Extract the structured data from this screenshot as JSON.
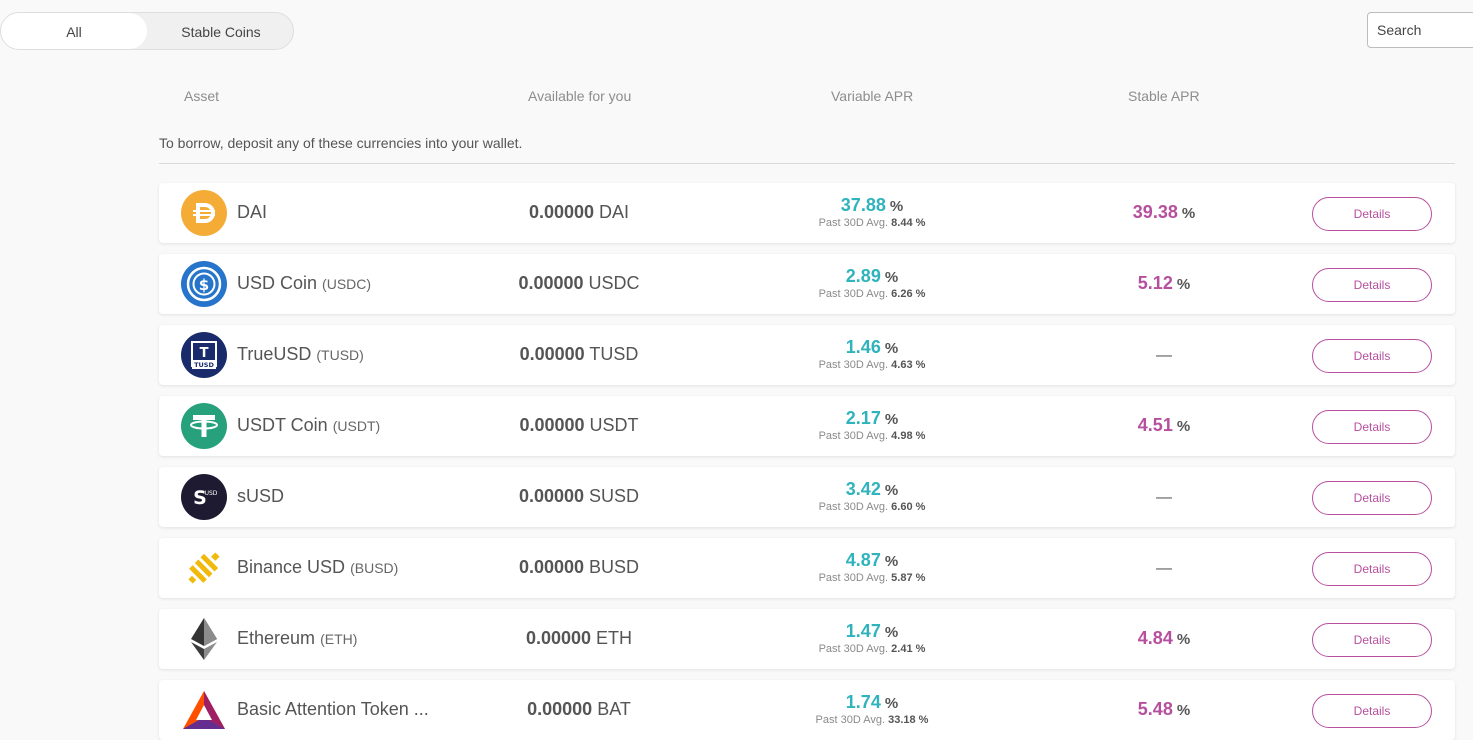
{
  "tabs": {
    "all": "All",
    "stable": "Stable Coins"
  },
  "search": {
    "placeholder": "Search"
  },
  "headers": {
    "asset": "Asset",
    "available": "Available for you",
    "variable": "Variable APR",
    "stable": "Stable APR"
  },
  "notice": "To borrow, deposit any of these currencies into your wallet.",
  "percent_sign": "%",
  "details_label": "Details",
  "avg_label": "Past 30D Avg.",
  "colors": {
    "variable": "#2fb3bc",
    "stable": "#b6509e"
  },
  "rows": [
    {
      "name": "DAI",
      "symbol": "",
      "amount": "0.00000",
      "unit": "DAI",
      "variable": "37.88",
      "avg": "8.44 %",
      "stable": "39.38",
      "icon": "dai-icon"
    },
    {
      "name": "USD Coin",
      "symbol": "(USDC)",
      "amount": "0.00000",
      "unit": "USDC",
      "variable": "2.89",
      "avg": "6.26 %",
      "stable": "5.12",
      "icon": "usdc-icon"
    },
    {
      "name": "TrueUSD",
      "symbol": "(TUSD)",
      "amount": "0.00000",
      "unit": "TUSD",
      "variable": "1.46",
      "avg": "4.63 %",
      "stable": "—",
      "icon": "tusd-icon"
    },
    {
      "name": "USDT Coin",
      "symbol": "(USDT)",
      "amount": "0.00000",
      "unit": "USDT",
      "variable": "2.17",
      "avg": "4.98 %",
      "stable": "4.51",
      "icon": "usdt-icon"
    },
    {
      "name": "sUSD",
      "symbol": "",
      "amount": "0.00000",
      "unit": "SUSD",
      "variable": "3.42",
      "avg": "6.60 %",
      "stable": "—",
      "icon": "susd-icon"
    },
    {
      "name": "Binance USD",
      "symbol": "(BUSD)",
      "amount": "0.00000",
      "unit": "BUSD",
      "variable": "4.87",
      "avg": "5.87 %",
      "stable": "—",
      "icon": "busd-icon"
    },
    {
      "name": "Ethereum",
      "symbol": "(ETH)",
      "amount": "0.00000",
      "unit": "ETH",
      "variable": "1.47",
      "avg": "2.41 %",
      "stable": "4.84",
      "icon": "eth-icon"
    },
    {
      "name": "Basic Attention Token ...",
      "symbol": "",
      "amount": "0.00000",
      "unit": "BAT",
      "variable": "1.74",
      "avg": "33.18 %",
      "stable": "5.48",
      "icon": "bat-icon"
    }
  ]
}
